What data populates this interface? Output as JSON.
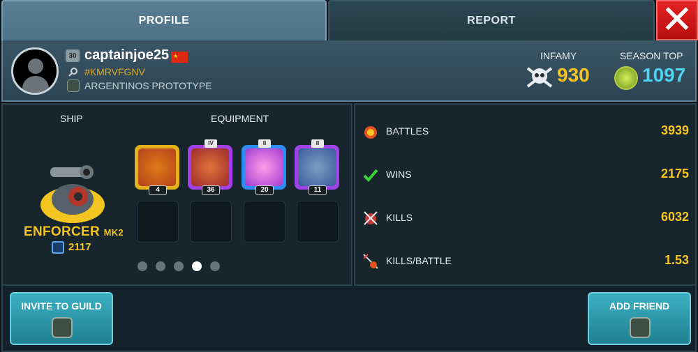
{
  "tabs": {
    "profile": "PROFILE",
    "report": "REPORT"
  },
  "close_label": "✕",
  "player": {
    "level": "30",
    "name": "captainjoe25",
    "tag": "#KMRVFGNV",
    "guild": "ARGENTINOS PROTOTYPE"
  },
  "stats_header": {
    "infamy_label": "INFAMY",
    "infamy_value": "930",
    "season_label": "SEASON TOP",
    "season_value": "1097"
  },
  "ship": {
    "section_label": "SHIP",
    "name": "ENFORCER",
    "mark": "MK2",
    "power": "2117"
  },
  "equipment": {
    "section_label": "EQUIPMENT",
    "slots": [
      {
        "count": "4",
        "rank": ""
      },
      {
        "count": "36",
        "rank": "IV"
      },
      {
        "count": "20",
        "rank": "II"
      },
      {
        "count": "11",
        "rank": "II"
      }
    ],
    "page_dots": 5,
    "active_dot": 4
  },
  "battle_stats": [
    {
      "label": "BATTLES",
      "value": "3939"
    },
    {
      "label": "WINS",
      "value": "2175"
    },
    {
      "label": "KILLS",
      "value": "6032"
    },
    {
      "label": "KILLS/BATTLE",
      "value": "1.53"
    }
  ],
  "buttons": {
    "invite": "INVITE TO GUILD",
    "add_friend": "ADD FRIEND"
  },
  "colors": {
    "gold": "#f4c424",
    "cyan": "#4fd3f0",
    "close_red": "#e52222",
    "button_teal": "#2a9aad"
  }
}
